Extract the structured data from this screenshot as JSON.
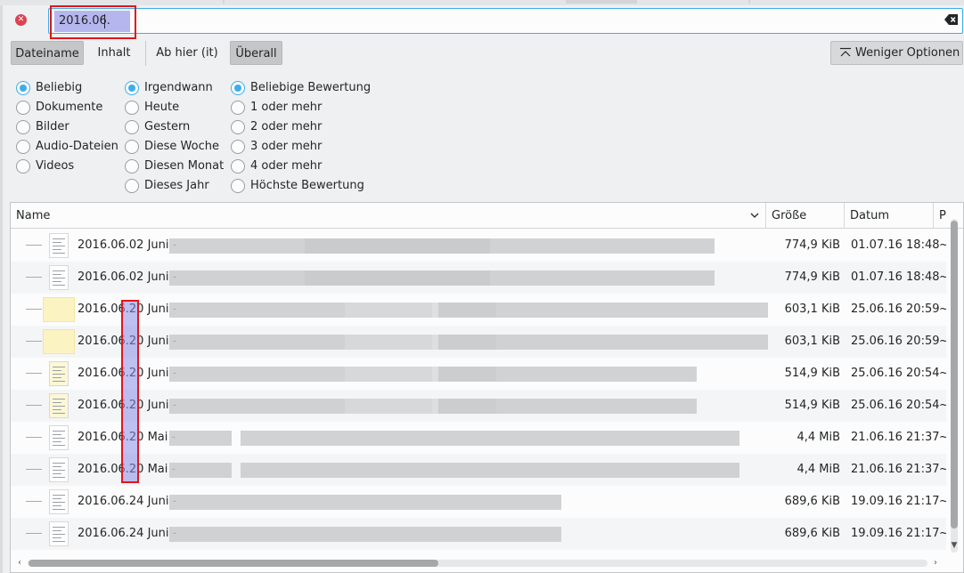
{
  "search": {
    "query": "2016.06."
  },
  "modes": {
    "filename": "Dateiname",
    "content": "Inhalt",
    "from_here": "Ab hier (it)",
    "everywhere": "Überall",
    "fewer_options": "Weniger Optionen"
  },
  "filters": {
    "type": [
      {
        "label": "Beliebig",
        "checked": true
      },
      {
        "label": "Dokumente",
        "checked": false
      },
      {
        "label": "Bilder",
        "checked": false
      },
      {
        "label": "Audio-Dateien",
        "checked": false
      },
      {
        "label": "Videos",
        "checked": false
      }
    ],
    "time": [
      {
        "label": "Irgendwann",
        "checked": true
      },
      {
        "label": "Heute",
        "checked": false
      },
      {
        "label": "Gestern",
        "checked": false
      },
      {
        "label": "Diese Woche",
        "checked": false
      },
      {
        "label": "Diesen Monat",
        "checked": false
      },
      {
        "label": "Dieses Jahr",
        "checked": false
      }
    ],
    "rating": [
      {
        "label": "Beliebige Bewertung",
        "checked": true
      },
      {
        "label": "1 oder mehr",
        "checked": false
      },
      {
        "label": "2 oder mehr",
        "checked": false
      },
      {
        "label": "3 oder mehr",
        "checked": false
      },
      {
        "label": "4 oder mehr",
        "checked": false
      },
      {
        "label": "Höchste Bewertung",
        "checked": false
      }
    ]
  },
  "table": {
    "columns": {
      "name": "Name",
      "size": "Größe",
      "date": "Datum",
      "extra": "P"
    },
    "rows": [
      {
        "name": "2016.06.02 Juni -",
        "size": "774,9 KiB",
        "date": "01.07.16 18:48",
        "extra": "~"
      },
      {
        "name": "2016.06.02 Juni -",
        "size": "774,9 KiB",
        "date": "01.07.16 18:48",
        "extra": "~"
      },
      {
        "name": "2016.06.20 Juni -",
        "size": "603,1 KiB",
        "date": "25.06.16 20:59",
        "extra": "~"
      },
      {
        "name": "2016.06.20 Juni -",
        "size": "603,1 KiB",
        "date": "25.06.16 20:59",
        "extra": "~"
      },
      {
        "name": "2016.06.20 Juni -",
        "size": "514,9 KiB",
        "date": "25.06.16 20:54",
        "extra": "~"
      },
      {
        "name": "2016.06.20 Juni -",
        "size": "514,9 KiB",
        "date": "25.06.16 20:54",
        "extra": "~"
      },
      {
        "name": "2016.06.20 Mai -",
        "size": "4,4 MiB",
        "date": "21.06.16 21:37",
        "extra": "~"
      },
      {
        "name": "2016.06.20 Mai -",
        "size": "4,4 MiB",
        "date": "21.06.16 21:37",
        "extra": "~"
      },
      {
        "name": "2016.06.24 Juni -",
        "size": "689,6 KiB",
        "date": "19.09.16 21:17",
        "extra": "~"
      },
      {
        "name": "2016.06.24 Juni -",
        "size": "689,6 KiB",
        "date": "19.09.16 21:17",
        "extra": "~"
      }
    ]
  },
  "colors": {
    "accent": "#3daee9",
    "annotation": "#e0161c",
    "selection": "#b6b6ee"
  }
}
